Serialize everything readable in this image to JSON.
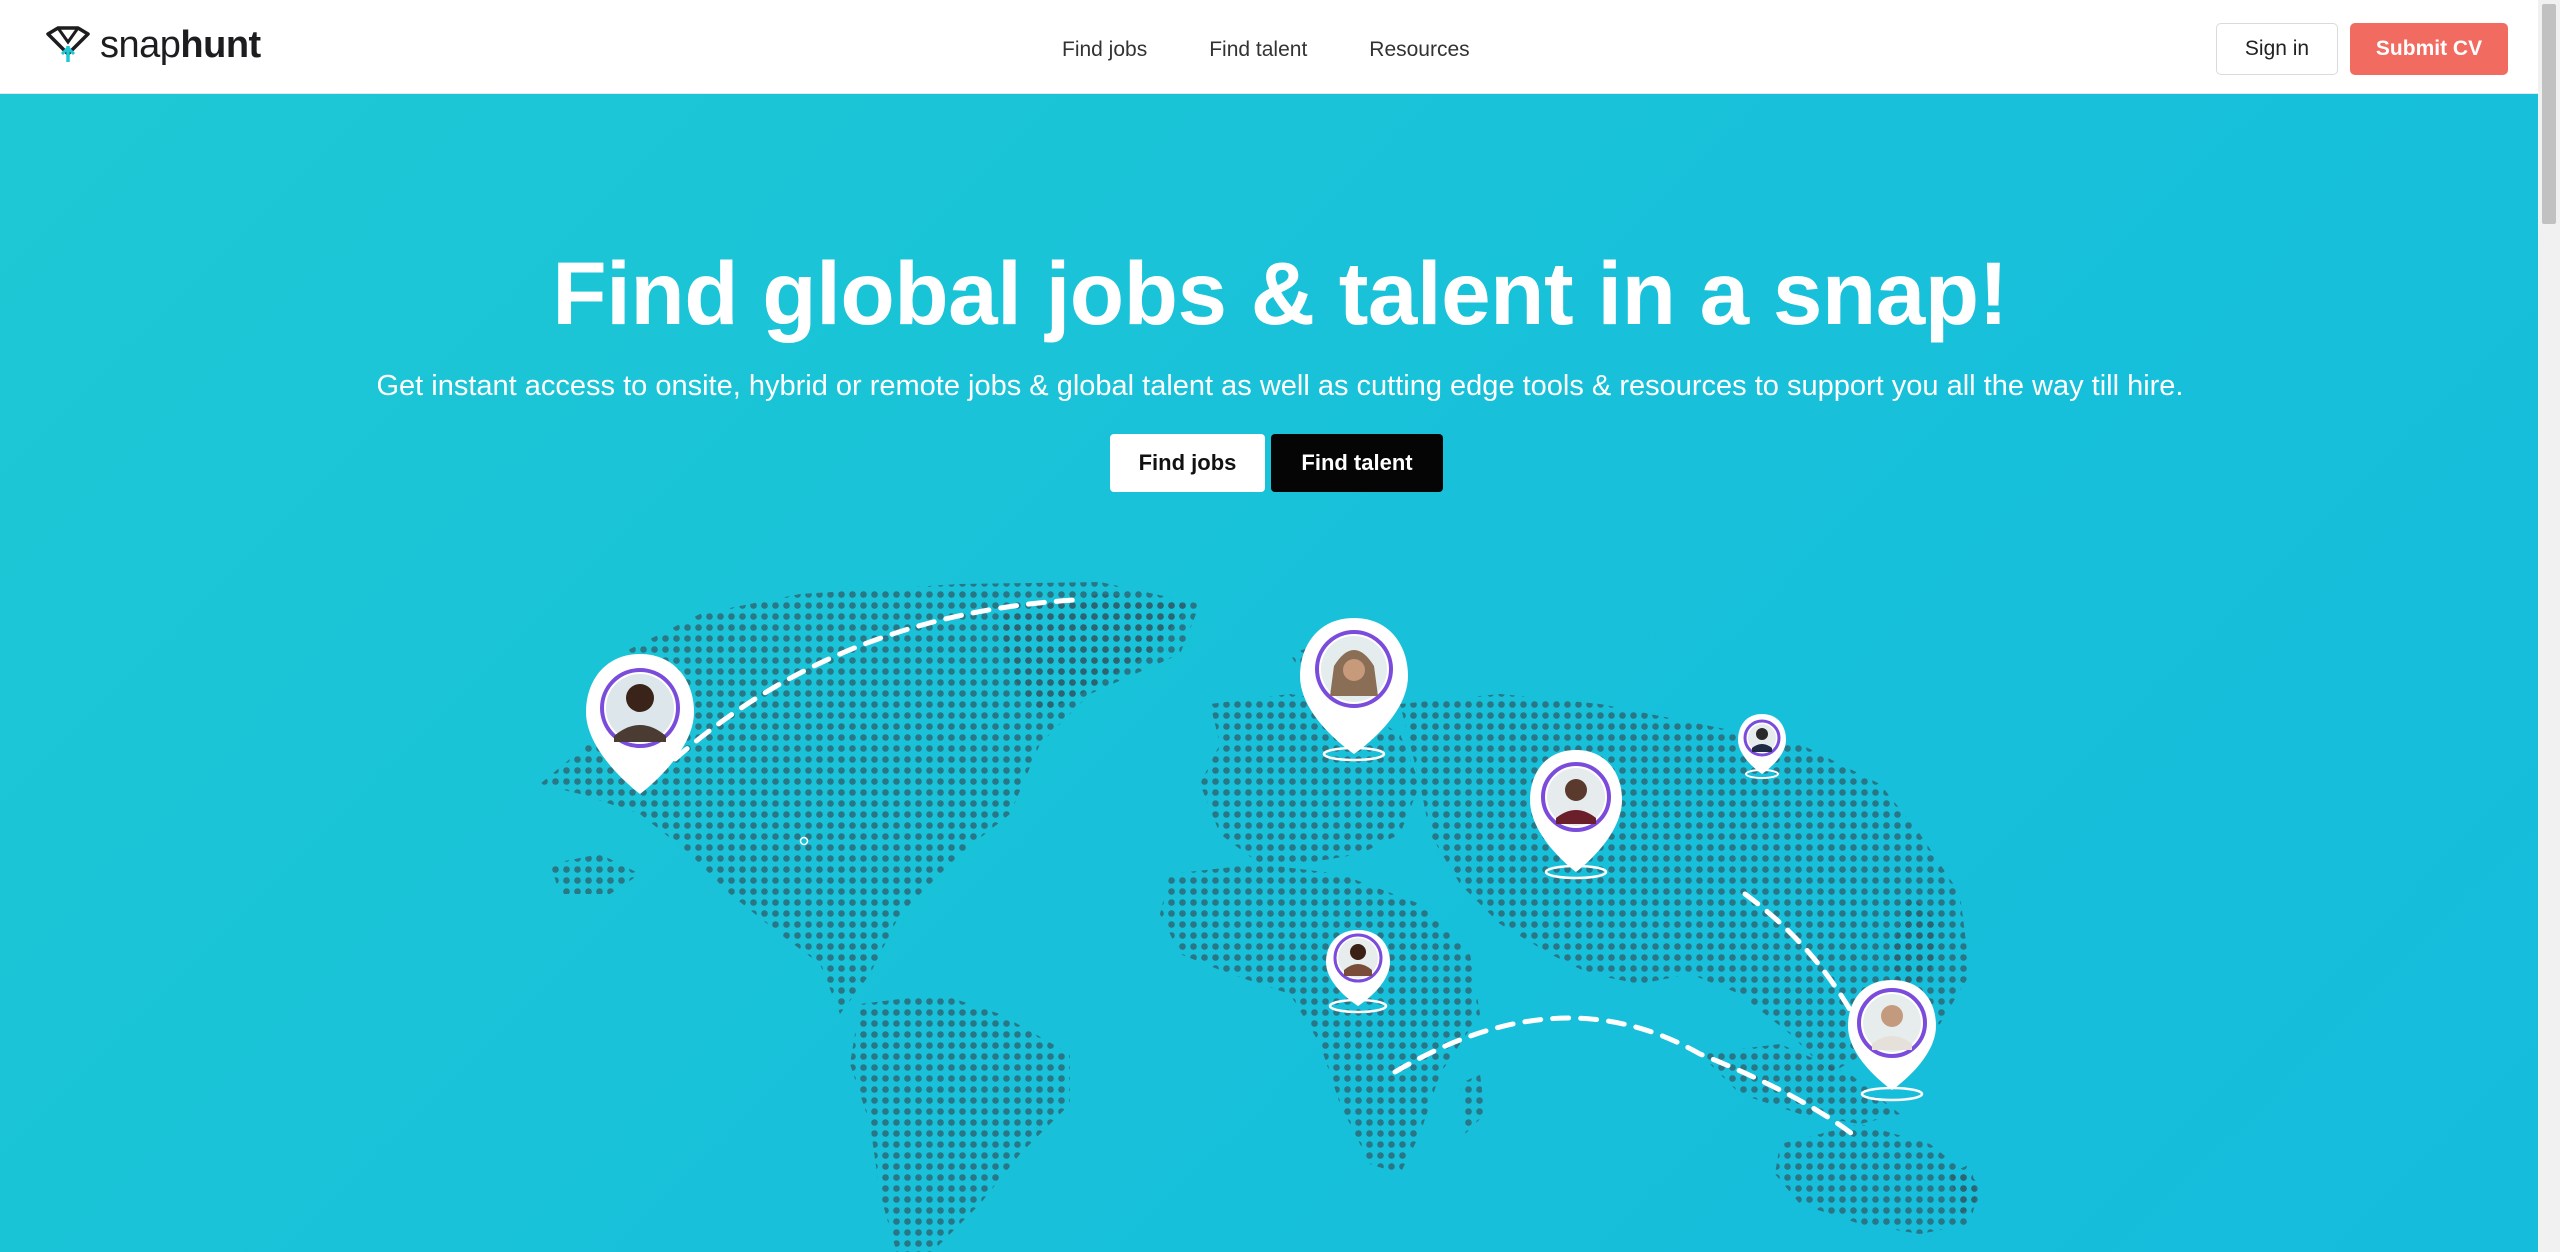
{
  "brand": {
    "name_light": "snap",
    "name_bold": "hunt",
    "accent_color": "#1ec8d4",
    "cta_color": "#f26b61"
  },
  "nav": {
    "links": [
      "Find jobs",
      "Find talent",
      "Resources"
    ],
    "sign_in": "Sign in",
    "submit_cv": "Submit CV"
  },
  "hero": {
    "title": "Find global jobs & talent in a snap!",
    "subtitle": "Get instant access to onsite, hybrid or remote jobs & global talent as well as cutting edge tools & resources to support you all the way till hire.",
    "btn_jobs": "Find jobs",
    "btn_talent": "Find talent"
  },
  "map": {
    "icon": "world-map-dots",
    "pins": [
      "person-pin-icon",
      "person-pin-icon",
      "person-pin-icon",
      "person-pin-icon",
      "person-pin-icon",
      "person-pin-icon"
    ]
  }
}
